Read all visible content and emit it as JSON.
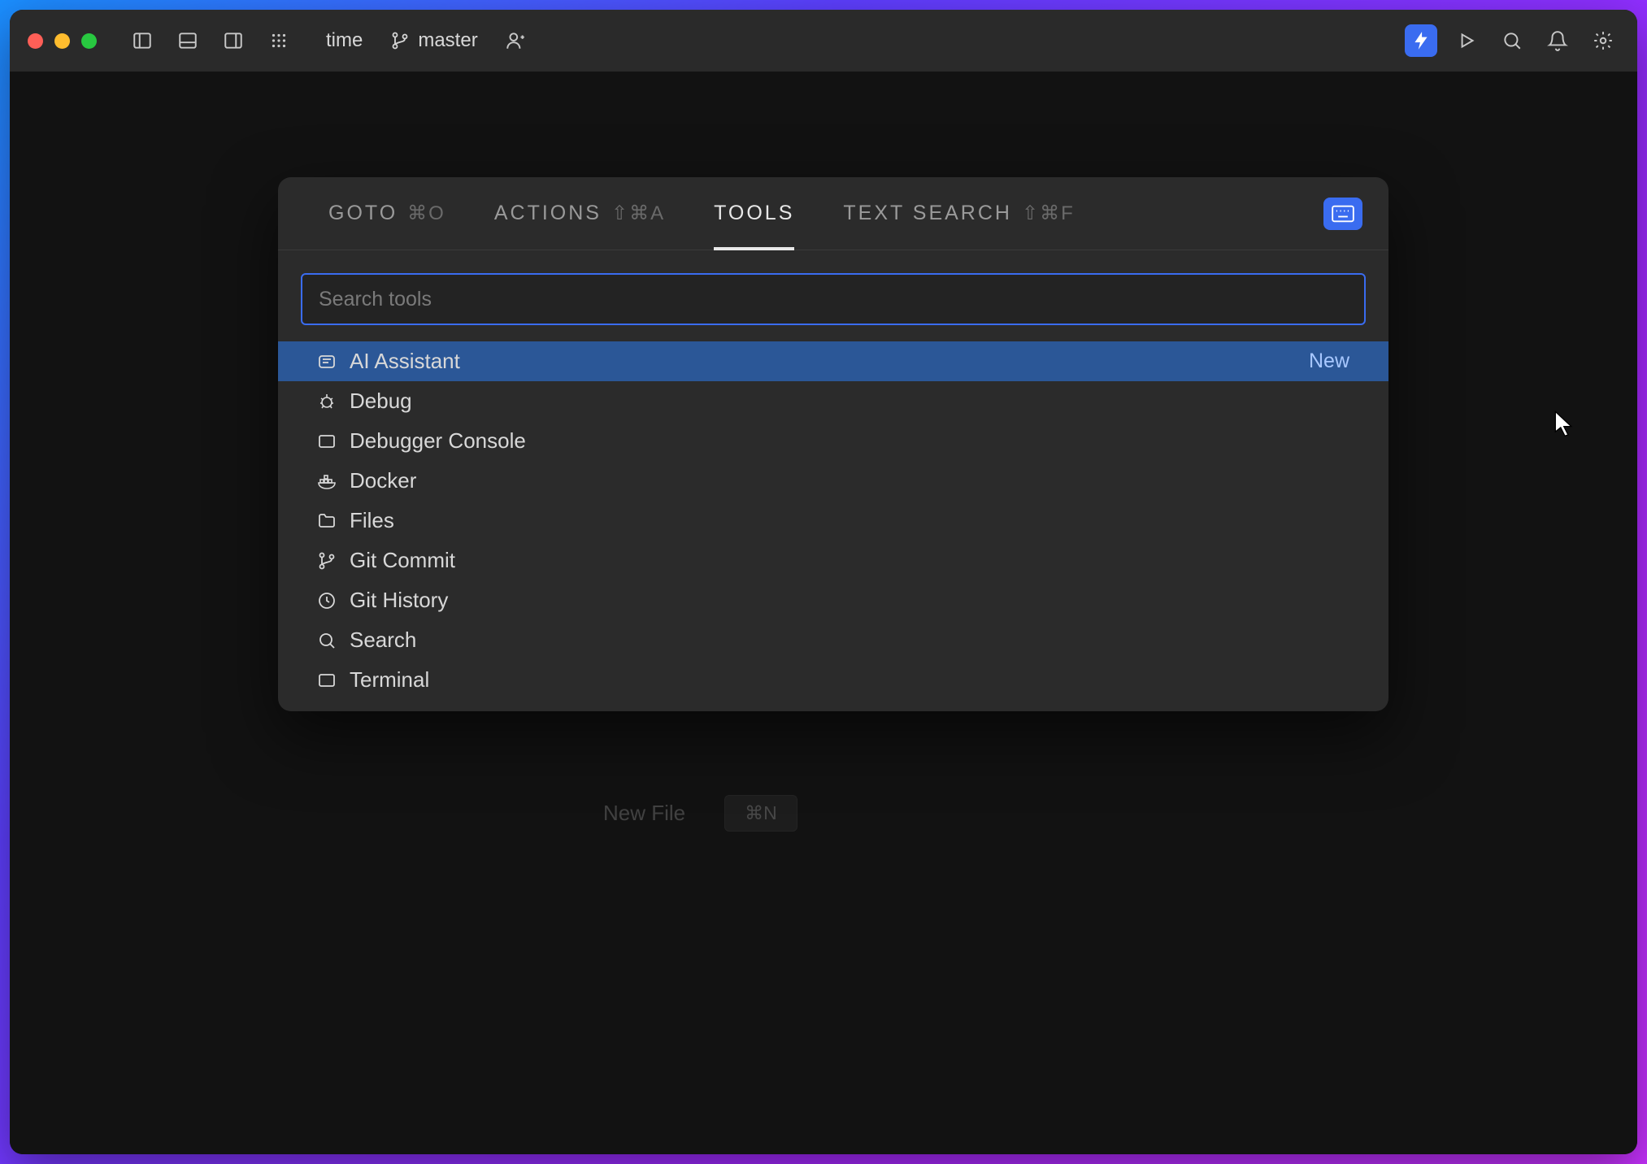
{
  "titlebar": {
    "project": "time",
    "branch": "master"
  },
  "palette": {
    "tabs": {
      "goto": {
        "label": "GOTO",
        "shortcut": "⌘O"
      },
      "actions": {
        "label": "ACTIONS",
        "shortcut": "⇧⌘A"
      },
      "tools": {
        "label": "TOOLS"
      },
      "textsearch": {
        "label": "TEXT SEARCH",
        "shortcut": "⇧⌘F"
      }
    },
    "search_placeholder": "Search tools",
    "tools": [
      {
        "label": "AI Assistant",
        "icon": "ai",
        "badge": "New"
      },
      {
        "label": "Debug",
        "icon": "bug"
      },
      {
        "label": "Debugger Console",
        "icon": "panel"
      },
      {
        "label": "Docker",
        "icon": "docker"
      },
      {
        "label": "Files",
        "icon": "folder"
      },
      {
        "label": "Git Commit",
        "icon": "git-branch"
      },
      {
        "label": "Git History",
        "icon": "clock"
      },
      {
        "label": "Search",
        "icon": "search"
      },
      {
        "label": "Terminal",
        "icon": "panel"
      }
    ]
  },
  "background": {
    "newfile_label": "New File",
    "newfile_shortcut": "⌘N"
  }
}
